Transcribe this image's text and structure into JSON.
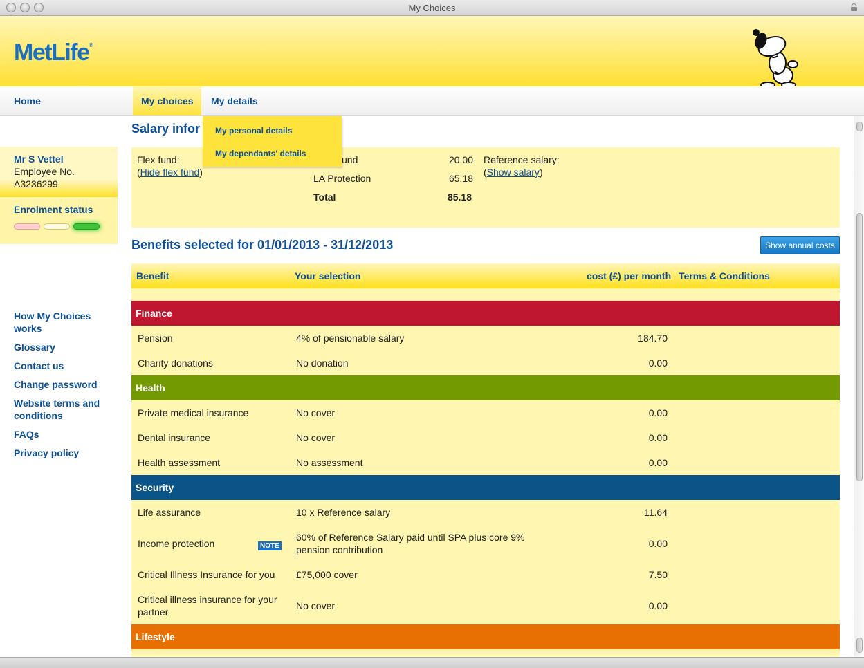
{
  "window": {
    "title": "My Choices"
  },
  "header": {
    "logo": "MetLife"
  },
  "nav": {
    "home": "Home",
    "my_choices": "My choices",
    "my_details": "My details",
    "dropdown": [
      "My personal details",
      "My dependants' details"
    ]
  },
  "user": {
    "name": "Mr S Vettel",
    "employee_label": "Employee No.",
    "employee_no": "A3236299"
  },
  "enrolment": {
    "title": "Enrolment status",
    "steps": [
      "inactive",
      "inactive",
      "active"
    ]
  },
  "sidebar_links": [
    "How My Choices works",
    "Glossary",
    "Contact us",
    "Change password",
    "Website terms and conditions",
    "FAQs",
    "Privacy policy"
  ],
  "salary": {
    "heading": "Salary infor",
    "flex_label": "Flex fund:",
    "hide_flex": "Hide flex fund",
    "fund_rows": [
      {
        "label": "und",
        "value": "20.00"
      },
      {
        "label": "LA Protection",
        "value": "65.18"
      },
      {
        "label": "Total",
        "value": "85.18"
      }
    ],
    "reference_label": "Reference salary:",
    "show_salary": "Show salary"
  },
  "benefits": {
    "heading": "Benefits selected for 01/01/2013 - 31/12/2013",
    "annual_button": "Show annual costs",
    "columns": {
      "benefit": "Benefit",
      "selection": "Your selection",
      "cost": "cost (£) per month",
      "terms": "Terms & Conditions"
    },
    "note_label": "NOTE",
    "categories": [
      {
        "name": "Finance",
        "color": "#bf1730",
        "rows": [
          {
            "benefit": "Pension",
            "selection": "4% of pensionable salary",
            "cost": "184.70"
          },
          {
            "benefit": "Charity donations",
            "selection": "No donation",
            "cost": "0.00"
          }
        ]
      },
      {
        "name": "Health",
        "color": "#739a00",
        "rows": [
          {
            "benefit": "Private medical insurance",
            "selection": "No cover",
            "cost": "0.00"
          },
          {
            "benefit": "Dental insurance",
            "selection": "No cover",
            "cost": "0.00"
          },
          {
            "benefit": "Health assessment",
            "selection": "No assessment",
            "cost": "0.00"
          }
        ]
      },
      {
        "name": "Security",
        "color": "#0b5487",
        "rows": [
          {
            "benefit": "Life assurance",
            "selection": "10 x Reference salary",
            "cost": "11.64"
          },
          {
            "benefit": "Income protection",
            "selection": "60% of Reference Salary paid until SPA plus core 9% pension contribution",
            "cost": "0.00",
            "note": true,
            "tall": true
          },
          {
            "benefit": "Critical Illness Insurance for you",
            "selection": "£75,000 cover",
            "cost": "7.50"
          },
          {
            "benefit": "Critical illness insurance for your partner",
            "selection": "No cover",
            "cost": "0.00",
            "tall": true
          }
        ]
      },
      {
        "name": "Lifestyle",
        "color": "#e87000",
        "rows": []
      }
    ]
  }
}
